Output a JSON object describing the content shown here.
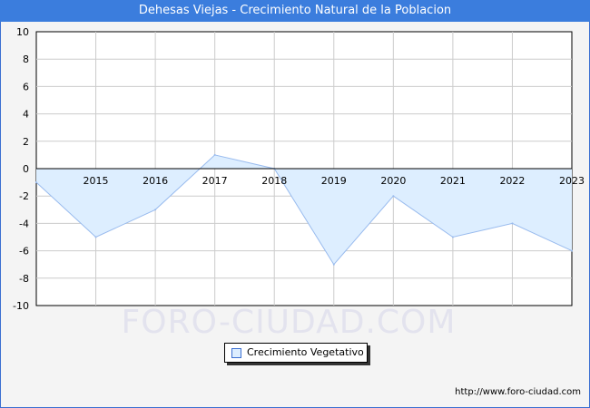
{
  "title": "Dehesas Viejas - Crecimiento Natural de la Poblacion",
  "watermark": "FORO-CIUDAD.COM",
  "footer_url": "http://www.foro-ciudad.com",
  "colors": {
    "title_bar": "#3b7ddd",
    "fill": "#ddeeff",
    "line": "#99bbee",
    "grid": "#cccccc",
    "background": "#f4f4f4"
  },
  "chart_data": {
    "type": "area",
    "title": "Dehesas Viejas - Crecimiento Natural de la Poblacion",
    "x": [
      2014,
      2015,
      2016,
      2017,
      2018,
      2019,
      2020,
      2021,
      2022,
      2023
    ],
    "x_tick_labels": [
      "2015",
      "2016",
      "2017",
      "2018",
      "2019",
      "2020",
      "2021",
      "2022",
      "2023"
    ],
    "y_tick_labels": [
      "10",
      "8",
      "6",
      "4",
      "2",
      "0",
      "-2",
      "-4",
      "-6",
      "-8",
      "-10"
    ],
    "series": [
      {
        "name": "Crecimiento Vegetativo",
        "values": [
          -1,
          -5,
          -3,
          1,
          0,
          -7,
          -2,
          -5,
          -4,
          -6
        ]
      }
    ],
    "ylim": [
      -10,
      10
    ],
    "xlim": [
      2014,
      2023
    ],
    "grid": true,
    "legend_position": "bottom-center"
  }
}
